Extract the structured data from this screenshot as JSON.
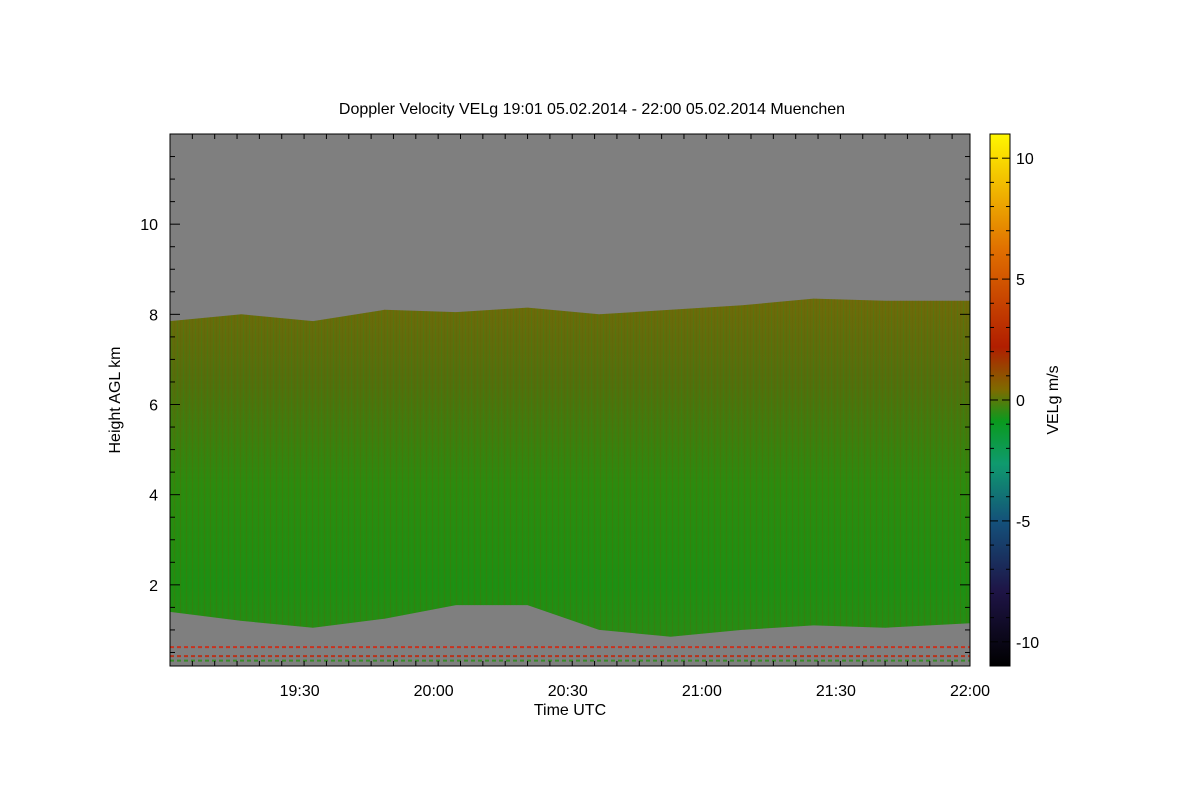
{
  "chart_data": {
    "type": "heatmap",
    "title": "Doppler Velocity VELg   19:01 05.02.2014 - 22:00 05.02.2014 Muenchen",
    "xlabel": "Time UTC",
    "ylabel": "Height AGL km",
    "x_range": [
      "19:01",
      "22:00"
    ],
    "x_ticks": [
      "19:30",
      "20:00",
      "20:30",
      "21:00",
      "21:30",
      "22:00"
    ],
    "ylim": [
      0.2,
      12
    ],
    "y_ticks": [
      "2",
      "4",
      "6",
      "8",
      "10"
    ],
    "colorbar": {
      "label": "VELg m/s",
      "range": [
        -11,
        11
      ],
      "ticks": [
        "10",
        "5",
        "0",
        "-5",
        "-10"
      ],
      "colors": [
        "#000000",
        "#1e1446",
        "#14507a",
        "#0f9a6e",
        "#0a9a1e",
        "#7f6a00",
        "#b11e00",
        "#e06e00",
        "#fff700"
      ]
    },
    "background_color": "#7f7f7f",
    "cloud_layer": {
      "description_values": "mostly -1 to 1 m/s",
      "base_km": [
        1.4,
        1.2,
        1.05,
        1.25,
        1.55,
        1.55,
        1.0,
        0.85,
        1.0,
        1.1,
        1.05,
        1.15
      ],
      "top_km": [
        7.85,
        8.0,
        7.85,
        8.1,
        8.05,
        8.15,
        8.0,
        8.1,
        8.2,
        8.35,
        8.3,
        8.3
      ],
      "times": [
        "19:01",
        "19:17",
        "19:33",
        "19:49",
        "20:05",
        "20:21",
        "20:37",
        "20:53",
        "21:09",
        "21:25",
        "21:41",
        "22:00"
      ]
    },
    "grid": false
  }
}
